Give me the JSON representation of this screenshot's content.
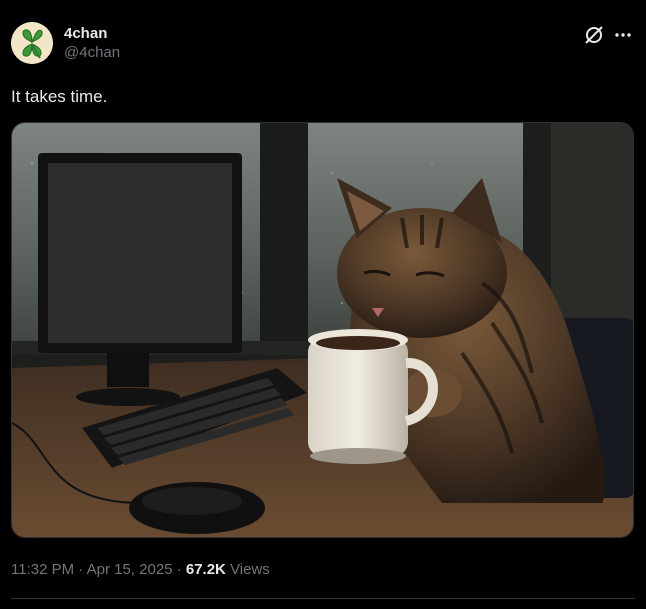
{
  "author": {
    "display_name": "4chan",
    "handle": "@4chan"
  },
  "tweet": {
    "text": "It takes time.",
    "time": "11:32 PM",
    "separator": "·",
    "date": "Apr 15, 2025",
    "views_count": "67.2K",
    "views_label": "Views"
  },
  "icons": {
    "grok": "grok-icon",
    "more": "more-options-icon",
    "avatar": "four-leaf-clover-icon"
  },
  "colors": {
    "background": "#000000",
    "primary_text": "#e7e9ea",
    "secondary_text": "#71767b",
    "clover": "#3a9a3a"
  }
}
